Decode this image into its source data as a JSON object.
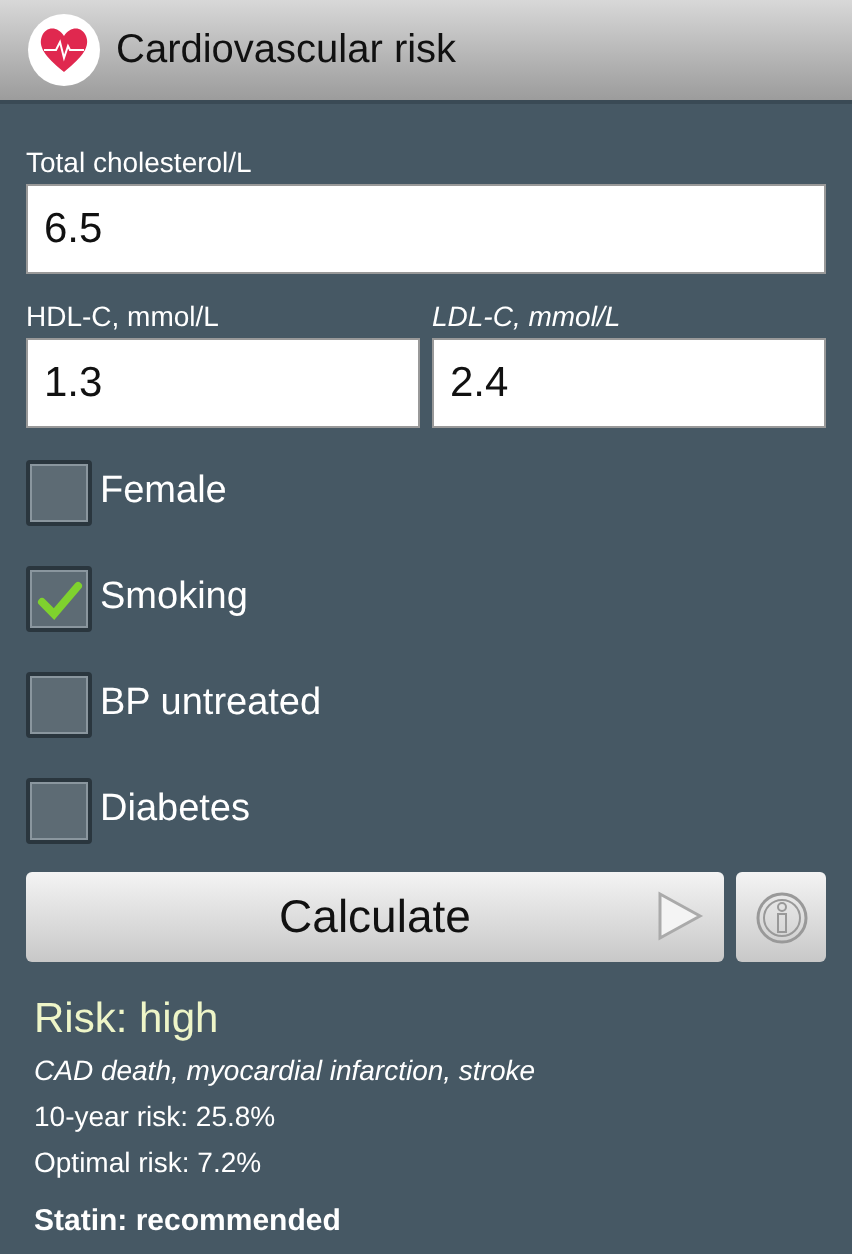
{
  "app_bar": {
    "title": "Cardiovascular risk"
  },
  "total_cholesterol": {
    "label": "Total cholesterol/L",
    "value": "6.5"
  },
  "hdl": {
    "label": "HDL-C, mmol/L",
    "value": "1.3"
  },
  "ldl": {
    "label": "LDL-C, mmol/L",
    "value": "2.4"
  },
  "options": [
    {
      "label": "Female",
      "checked": false
    },
    {
      "label": "Smoking",
      "checked": true
    },
    {
      "label": "BP untreated",
      "checked": false
    },
    {
      "label": "Diabetes",
      "checked": false
    }
  ],
  "calculate_button": "Calculate",
  "result": {
    "risk": "Risk: high",
    "outcomes": "CAD death, myocardial infarction, stroke",
    "ten_year": "10-year risk: 25.8%",
    "optimal": "Optimal risk: 7.2%",
    "statin": "Statin: recommended"
  }
}
